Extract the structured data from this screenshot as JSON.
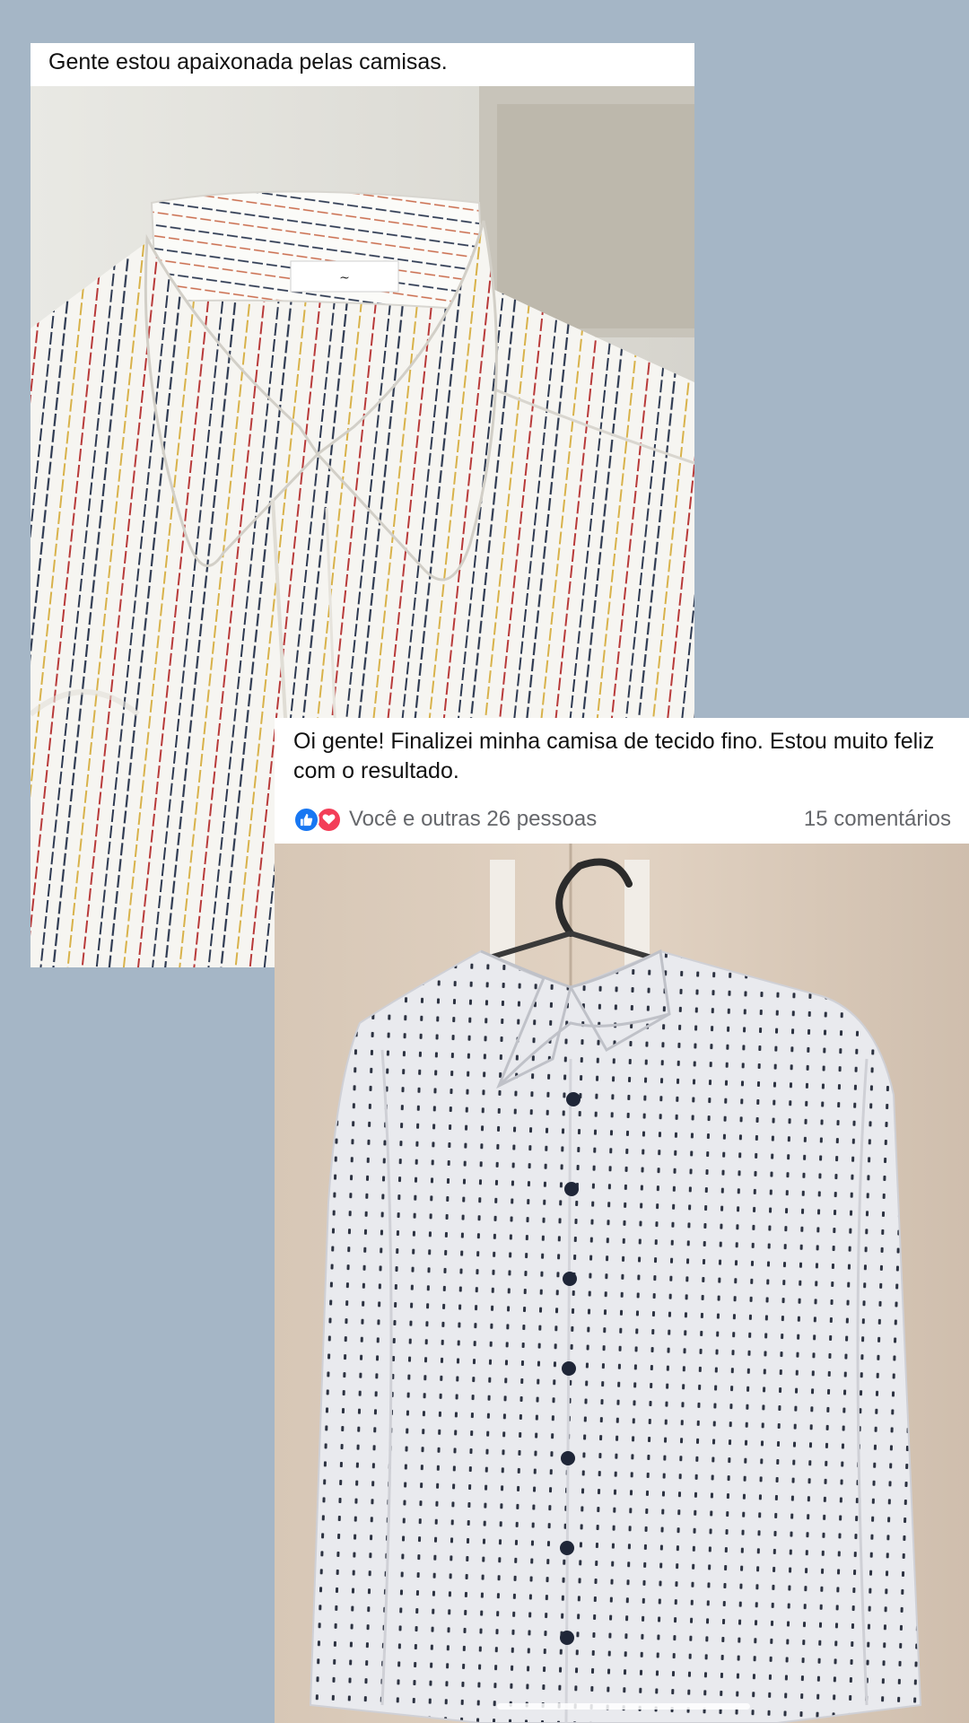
{
  "post1": {
    "caption": "Gente estou apaixonada pelas camisas.",
    "photo_icon": "striped-shirt-collar-photo"
  },
  "post2": {
    "caption": "Oi gente! Finalizei minha camisa de tecido fino. Estou muito feliz com o resultado.",
    "reactions": {
      "icons": [
        "like-icon",
        "love-icon"
      ],
      "text": "Você e outras 26 pessoas",
      "comments": "15 comentários"
    },
    "photo_icon": "polka-dot-shirt-on-hanger-photo"
  },
  "colors": {
    "background": "#a5b6c6",
    "like": "#1877f2",
    "love": "#f33e58",
    "meta_text": "#65676b"
  }
}
